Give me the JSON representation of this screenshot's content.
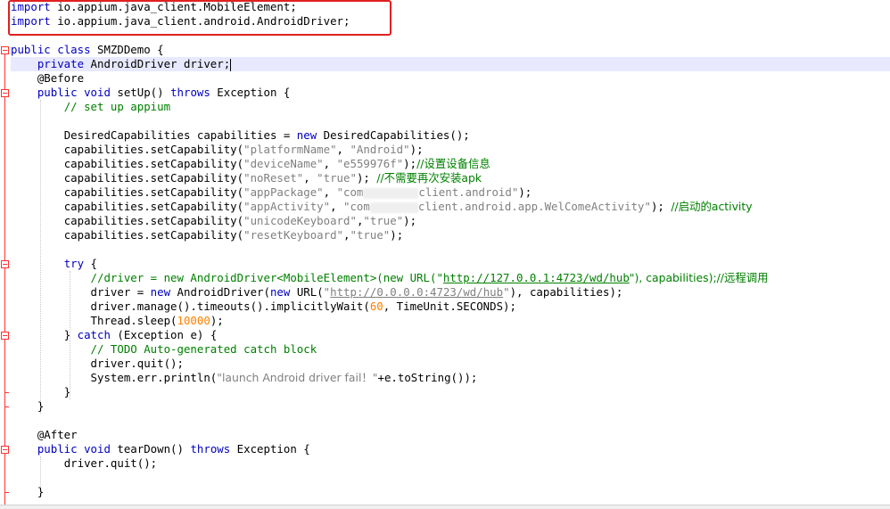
{
  "code": {
    "imports": [
      {
        "kw": "import",
        "path": " io.appium.java_client.MobileElement;"
      },
      {
        "kw": "import",
        "path": " io.appium.java_client.android.AndroidDriver;"
      }
    ],
    "class_decl": {
      "kw1": "public",
      "kw2": "class",
      "name": " SMZDDemo {"
    },
    "field": {
      "kw": "private",
      "rest": " AndroidDriver driver;"
    },
    "before_annotation": "@Before",
    "setup_sig": {
      "kw1": "public",
      "kw2": "void",
      "name": " setUp() ",
      "kw3": "throws",
      "rest": " Exception {"
    },
    "setup_comment": "// set up appium",
    "caps_decl": {
      "pre": "DesiredCapabilities capabilities = ",
      "kw": "new",
      "post": " DesiredCapabilities();"
    },
    "caps": [
      {
        "pre": "capabilities.setCapability(",
        "key": "\"platformName\"",
        "mid": ", ",
        "val": "\"Android\"",
        "post": ");",
        "comment": ""
      },
      {
        "pre": "capabilities.setCapability(",
        "key": "\"deviceName\"",
        "mid": ", ",
        "val": "\"e559976f\"",
        "post": ");",
        "comment": "//设置设备信息"
      },
      {
        "pre": "capabilities.setCapability(",
        "key": "\"noReset\"",
        "mid": ", ",
        "val": "\"true\"",
        "post": "); ",
        "comment": "//不需要再次安装apk"
      },
      {
        "pre": "capabilities.setCapability(",
        "key": "\"appPackage\"",
        "mid": ", ",
        "val_a": "\"com",
        "val_b": "client.android\"",
        "post": ");",
        "comment": ""
      },
      {
        "pre": "capabilities.setCapability(",
        "key": "\"appActivity\"",
        "mid": ", ",
        "val_a": "\"com",
        "val_b": "client.android.app.WelComeActivity\"",
        "post": "); ",
        "comment": "//启动的activity"
      },
      {
        "pre": "capabilities.setCapability(",
        "key": "\"unicodeKeyboard\"",
        "mid": ",",
        "val": "\"true\"",
        "post": ");",
        "comment": ""
      },
      {
        "pre": "capabilities.setCapability(",
        "key": "\"resetKeyboard\"",
        "mid": ",",
        "val": "\"true\"",
        "post": ");",
        "comment": ""
      }
    ],
    "try_kw": "try",
    "try_rest": " {",
    "commented_driver": {
      "a": "//driver = new AndroidDriver<MobileElement>(new URL(\"",
      "url": "http://127.0.0.1:4723/wd/hub",
      "b": "\"), capabilities);//远程调用"
    },
    "driver_line": {
      "pre": "driver = ",
      "kw1": "new",
      "mid1": " AndroidDriver(",
      "kw2": "new",
      "mid2": " URL(",
      "q1": "\"",
      "url": "http://0.0.0.0:4723/wd/hub",
      "q2": "\"",
      "post": "), capabilities);"
    },
    "timeouts_line": {
      "pre": "driver.manage().timeouts().implicitlyWait(",
      "num": "60",
      "post": ", TimeUnit.SECONDS);"
    },
    "sleep_line": {
      "pre": "Thread.sleep(",
      "num": "10000",
      "post": ");"
    },
    "catch_line": {
      "pre": "} ",
      "kw": "catch",
      "post": " (Exception e) {"
    },
    "todo_comment": "// TODO Auto-generated catch block",
    "quit_line": "driver.quit();",
    "err_line": {
      "pre": "System.err.println(",
      "str": "\"launch Android driver fail！\"",
      "post": "+e.toString());"
    },
    "close_brace": "}",
    "after_annotation": "@After",
    "teardown_sig": {
      "kw1": "public",
      "kw2": "void",
      "name": " tearDown() ",
      "kw3": "throws",
      "rest": " Exception {"
    },
    "teardown_body": "driver.quit();"
  },
  "colors": {
    "keyword": "#0000c0",
    "string": "#808080",
    "comment": "#008000",
    "number": "#ff8000",
    "highlight_border": "#e02020",
    "current_line": "#e8e8ff"
  }
}
